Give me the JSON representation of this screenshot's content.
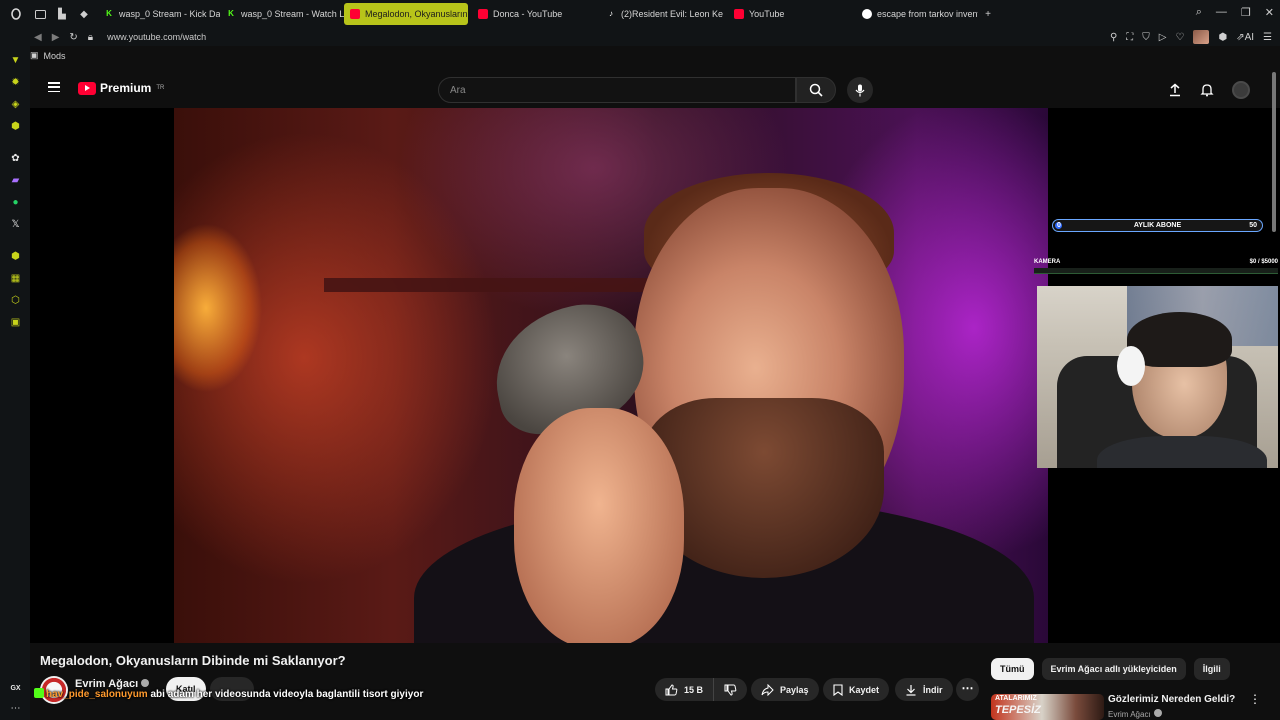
{
  "browser": {
    "tabs": [
      {
        "label": "wasp_0 Stream - Kick Das",
        "icon": "kick"
      },
      {
        "label": "wasp_0 Stream - Watch L",
        "icon": "kick"
      },
      {
        "label": "Megalodon, Okyanusların",
        "icon": "youtube",
        "active": true
      },
      {
        "label": "Donca - YouTube",
        "icon": "youtube"
      },
      {
        "label": "(2)Resident Evil: Leon Ke",
        "icon": "tiktok"
      },
      {
        "label": "YouTube",
        "icon": "youtube"
      },
      {
        "label": "escape from tarkov invent",
        "icon": "google"
      }
    ],
    "new_tab": "+",
    "url": "www.youtube.com/watch",
    "ai_label": "AI",
    "bookmark": "Mods",
    "gx_label": "GX"
  },
  "youtube": {
    "logo_text": "Premium",
    "logo_region": "TR",
    "search_placeholder": "Ara"
  },
  "overlay": {
    "sub_goal_current": "0",
    "sub_goal_label": "AYLIK ABONE",
    "sub_goal_target": "50",
    "camera_label": "KAMERA",
    "camera_amount": "$0  / $5000"
  },
  "video": {
    "title": "Megalodon, Okyanusların Dibinde mi Saklanıyor?",
    "channel": "Evrim Ağacı",
    "join_label": "Katıl",
    "likes": "15 B",
    "share_label": "Paylaş",
    "save_label": "Kaydet",
    "download_label": "İndir"
  },
  "chat": {
    "user": "hav_pide_salonuyum",
    "message": "abi adam her videosunda videoyla baglantili tisort giyiyor"
  },
  "sidebar": {
    "chips": [
      "Tümü",
      "Evrim Ağacı adlı yükleyiciden",
      "İlgili"
    ],
    "rec": {
      "thumb_top": "ATALARIMIZ",
      "thumb_big": "TEPESİZ",
      "title": "Gözlerimiz Nereden Geldi?",
      "channel": "Evrim Ağacı"
    }
  }
}
